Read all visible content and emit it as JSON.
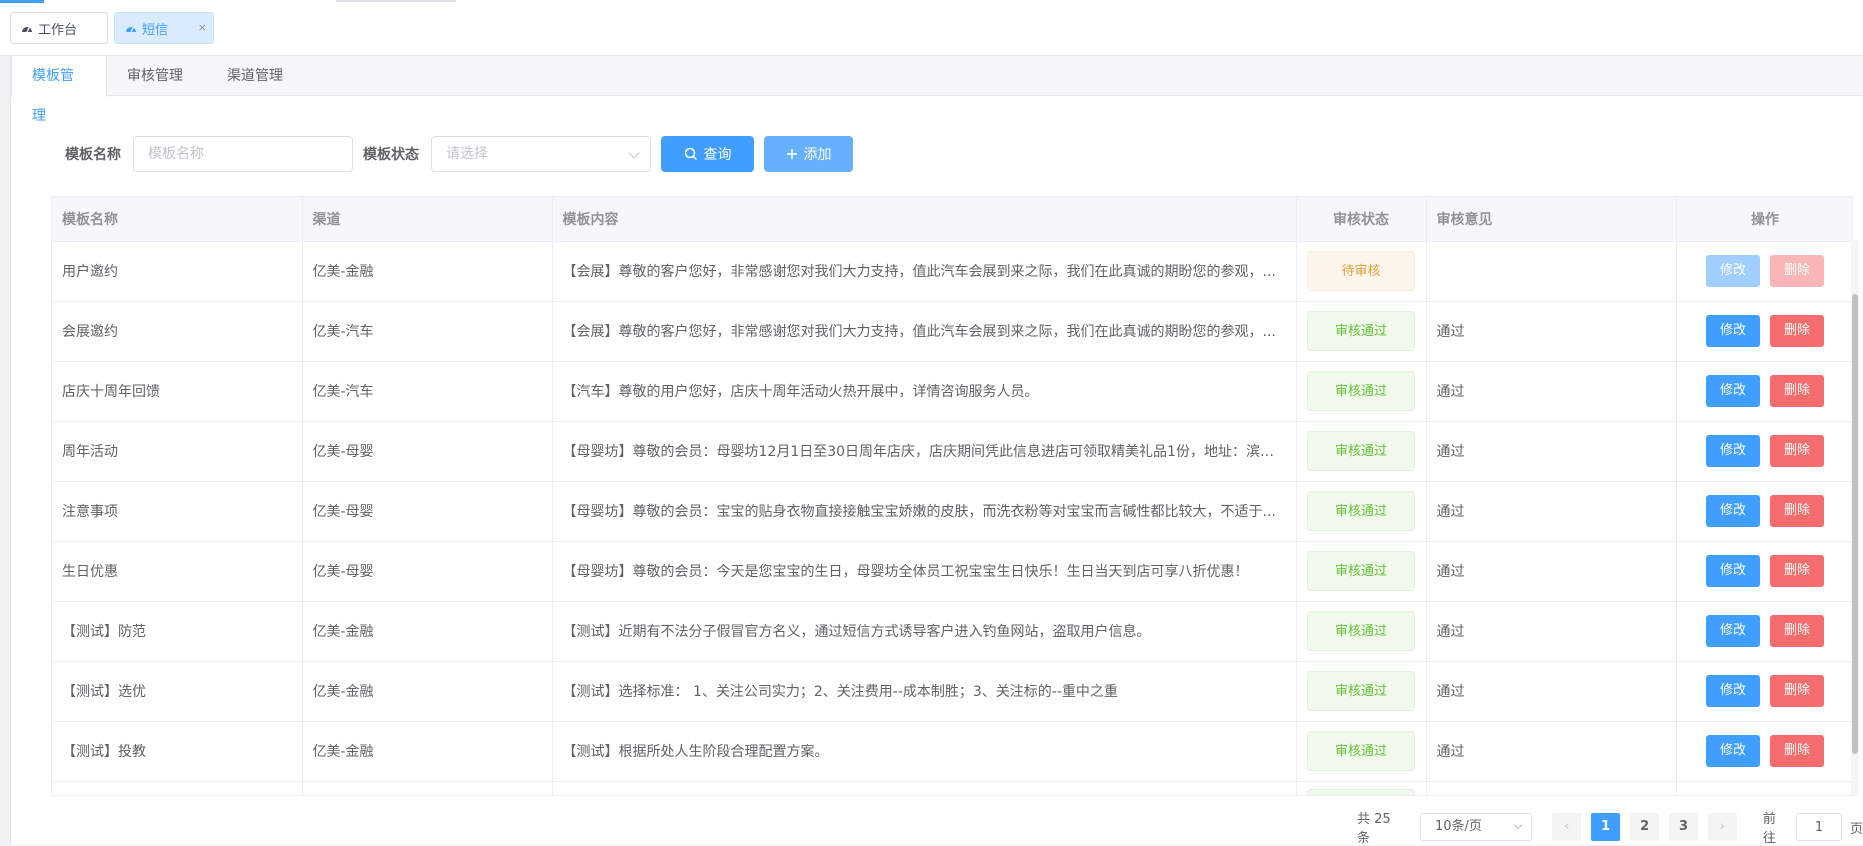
{
  "tags_bar": {
    "tabs": [
      {
        "label": "工作台",
        "icon": "dashboard-icon"
      },
      {
        "label": "短信",
        "icon": "dashboard-icon",
        "close": "×"
      }
    ]
  },
  "section_tabs": [
    "模板管理",
    "审核管理",
    "渠道管理"
  ],
  "search": {
    "name_label": "模板名称",
    "name_placeholder": "模板名称",
    "status_label": "模板状态",
    "status_placeholder": "请选择",
    "query_button": "查询",
    "add_button": "添加"
  },
  "table": {
    "columns": [
      "模板名称",
      "渠道",
      "模板内容",
      "审核状态",
      "审核意见",
      "操作"
    ],
    "edit_label": "修改",
    "delete_label": "删除",
    "rows": [
      {
        "name": "用户邀约",
        "channel": "亿美-金融",
        "content": "【会展】尊敬的客户您好，非常感谢您对我们大力支持，值此汽车会展到来之际，我们在此真诚的期盼您的参观，...",
        "status": "待审核",
        "status_type": "pending",
        "opinion": "",
        "disabled": true
      },
      {
        "name": "会展邀约",
        "channel": "亿美-汽车",
        "content": "【会展】尊敬的客户您好，非常感谢您对我们大力支持，值此汽车会展到来之际，我们在此真诚的期盼您的参观，...",
        "status": "审核通过",
        "status_type": "ok",
        "opinion": "通过",
        "disabled": false
      },
      {
        "name": "店庆十周年回馈",
        "channel": "亿美-汽车",
        "content": "【汽车】尊敬的用户您好，店庆十周年活动火热开展中，详情咨询服务人员。",
        "status": "审核通过",
        "status_type": "ok",
        "opinion": "通过",
        "disabled": false
      },
      {
        "name": "周年活动",
        "channel": "亿美-母婴",
        "content": "【母婴坊】尊敬的会员：母婴坊12月1日至30日周年店庆，店庆期间凭此信息进店可领取精美礼品1份，地址：滨江...",
        "status": "审核通过",
        "status_type": "ok",
        "opinion": "通过",
        "disabled": false
      },
      {
        "name": "注意事项",
        "channel": "亿美-母婴",
        "content": "【母婴坊】尊敬的会员：宝宝的贴身衣物直接接触宝宝娇嫩的皮肤，而洗衣粉等对宝宝而言碱性都比较大，不适于...",
        "status": "审核通过",
        "status_type": "ok",
        "opinion": "通过",
        "disabled": false
      },
      {
        "name": "生日优惠",
        "channel": "亿美-母婴",
        "content": "【母婴坊】尊敬的会员：今天是您宝宝的生日，母婴坊全体员工祝宝宝生日快乐！生日当天到店可享八折优惠！",
        "status": "审核通过",
        "status_type": "ok",
        "opinion": "通过",
        "disabled": false
      },
      {
        "name": "【测试】防范",
        "channel": "亿美-金融",
        "content": "【测试】近期有不法分子假冒官方名义，通过短信方式诱导客户进入钓鱼网站，盗取用户信息。",
        "status": "审核通过",
        "status_type": "ok",
        "opinion": "通过",
        "disabled": false
      },
      {
        "name": "【测试】选优",
        "channel": "亿美-金融",
        "content": "【测试】选择标准： 1、关注公司实力；2、关注费用--成本制胜；3、关注标的--重中之重",
        "status": "审核通过",
        "status_type": "ok",
        "opinion": "通过",
        "disabled": false
      },
      {
        "name": "【测试】投教",
        "channel": "亿美-金融",
        "content": "【测试】根据所处人生阶段合理配置方案。",
        "status": "审核通过",
        "status_type": "ok",
        "opinion": "通过",
        "disabled": false
      }
    ]
  },
  "pagination": {
    "total": "共 25 条",
    "page_size": "10条/页",
    "pages": [
      "1",
      "2",
      "3"
    ],
    "current": "1",
    "prev": "‹",
    "next": "›",
    "goto_label": "前往",
    "goto_value": "1",
    "goto_suffix": "页"
  },
  "colors": {
    "primary": "#409eff",
    "danger": "#f56c6c",
    "success": "#67c23a",
    "warning": "#e6a23c"
  }
}
